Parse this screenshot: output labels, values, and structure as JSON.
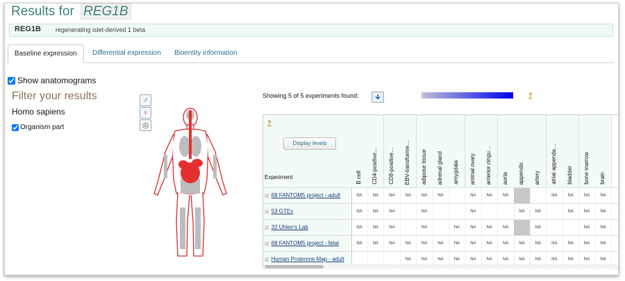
{
  "header": {
    "prefix": "Results for",
    "gene": "REG1B"
  },
  "gene_info": {
    "symbol": "REG1B",
    "description": "regenerating islet-derived 1 beta"
  },
  "tabs": [
    {
      "label": "Baseline expression",
      "active": true
    },
    {
      "label": "Differential expression",
      "active": false
    },
    {
      "label": "Bioentity information",
      "active": false
    }
  ],
  "show_anatomograms": {
    "label": "Show anatomograms",
    "checked": true
  },
  "filter": {
    "title": "Filter your results",
    "species": "Homo sapiens",
    "organism_part": {
      "label": "Organism part",
      "checked": true
    }
  },
  "anatomogram_buttons": [
    {
      "name": "male",
      "glyph": "♂"
    },
    {
      "name": "female",
      "glyph": "♀"
    },
    {
      "name": "brain",
      "glyph": "◎"
    }
  ],
  "results": {
    "showing_text": "Showing 5 of 5 experiments found:",
    "help_glyph": "?",
    "display_levels_label": "Display levels",
    "experiment_header": "Experiment",
    "columns": [
      "B cell",
      "CD4-positive…",
      "CD8-positive…",
      "EBV-transforme…",
      "adipose tissue",
      "adrenal gland",
      "amygdala",
      "animal ovary",
      "anterior cingu…",
      "aorta",
      "appendix",
      "artery",
      "atrial appenda…",
      "bladder",
      "bone marrow",
      "brain"
    ],
    "rows": [
      {
        "label": "68 FANTOM5 project - adult",
        "cells": [
          "NA",
          "NA",
          "NA",
          "NA",
          "NA",
          "NA",
          "",
          "NA",
          "NA",
          "NA",
          "",
          "",
          "NA",
          "NA",
          "NA",
          "NA"
        ],
        "grey": [
          10
        ]
      },
      {
        "label": "53 GTEx",
        "cells": [
          "NA",
          "NA",
          "NA",
          "",
          "NA",
          "",
          "",
          "NA",
          "",
          "",
          "NA",
          "NA",
          "",
          "NA",
          "NA",
          "NA"
        ],
        "grey": []
      },
      {
        "label": "32 Uhlen's Lab",
        "cells": [
          "NA",
          "NA",
          "NA",
          "",
          "NA",
          "",
          "NA",
          "NA",
          "NA",
          "NA",
          "",
          "NA",
          "",
          "",
          "NA",
          "NA"
        ],
        "grey": [
          10
        ]
      },
      {
        "label": "68 FANTOM5 project - fetal",
        "cells": [
          "NA",
          "NA",
          "NA",
          "NA",
          "NA",
          "NA",
          "NA",
          "NA",
          "NA",
          "NA",
          "NA",
          "NA",
          "NA",
          "NA",
          "NA",
          "NA"
        ],
        "grey": []
      },
      {
        "label": "Human Proteome Map - adult",
        "cells": [
          "",
          "",
          "",
          "NA",
          "NA",
          "NA",
          "NA",
          "NA",
          "NA",
          "NA",
          "NA",
          "NA",
          "NA",
          "NA",
          "NA",
          "NA"
        ],
        "grey": []
      }
    ]
  },
  "colors": {
    "title": "#3e7f7c",
    "filter_title": "#8b7251",
    "gradient_high": "#0000ee",
    "highlight": "#e53030"
  }
}
